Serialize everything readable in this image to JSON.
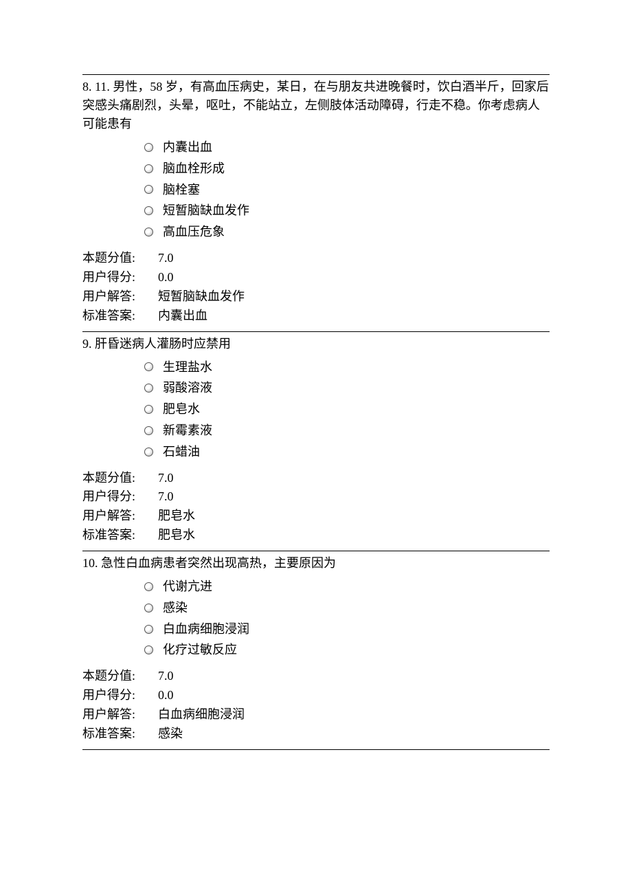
{
  "questions": [
    {
      "number": "8.",
      "text": "11. 男性，58 岁，有高血压病史，某日，在与朋友共进晚餐时，饮白酒半斤，回家后突感头痛剧烈，头晕，呕吐，不能站立，左侧肢体活动障碍，行走不稳。你考虑病人可能患有",
      "options": [
        "内囊出血",
        "脑血栓形成",
        "脑栓塞",
        "短暂脑缺血发作",
        "高血压危象"
      ],
      "summary": {
        "score_label": "本题分值:",
        "score_value": "7.0",
        "user_score_label": "用户得分:",
        "user_score_value": "0.0",
        "user_answer_label": "用户解答:",
        "user_answer_value": "短暂脑缺血发作",
        "standard_answer_label": "标准答案:",
        "standard_answer_value": "内囊出血"
      }
    },
    {
      "number": "9.",
      "text": "肝昏迷病人灌肠时应禁用",
      "options": [
        "生理盐水",
        "弱酸溶液",
        "肥皂水",
        "新霉素液",
        "石蜡油"
      ],
      "summary": {
        "score_label": "本题分值:",
        "score_value": "7.0",
        "user_score_label": "用户得分:",
        "user_score_value": "7.0",
        "user_answer_label": "用户解答:",
        "user_answer_value": "肥皂水",
        "standard_answer_label": "标准答案:",
        "standard_answer_value": "肥皂水"
      }
    },
    {
      "number": "10.",
      "text": "急性白血病患者突然出现高热，主要原因为",
      "options": [
        "代谢亢进",
        "感染",
        "白血病细胞浸润",
        "化疗过敏反应"
      ],
      "summary": {
        "score_label": "本题分值:",
        "score_value": "7.0",
        "user_score_label": "用户得分:",
        "user_score_value": "0.0",
        "user_answer_label": "用户解答:",
        "user_answer_value": "白血病细胞浸润",
        "standard_answer_label": "标准答案:",
        "standard_answer_value": "感染"
      }
    }
  ]
}
